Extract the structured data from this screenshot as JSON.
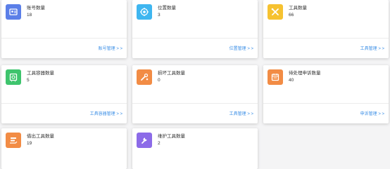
{
  "cards": [
    {
      "title": "账号数量",
      "value": "18",
      "link": "账号管理 > >",
      "icon": "user-id-icon",
      "color": "#5b7fe8"
    },
    {
      "title": "位置数量",
      "value": "3",
      "link": "位置管理 > >",
      "icon": "location-icon",
      "color": "#3fb6f0"
    },
    {
      "title": "工具数量",
      "value": "66",
      "link": "工具管理 > >",
      "icon": "tools-icon",
      "color": "#f6c231"
    },
    {
      "title": "工具容器数量",
      "value": "5",
      "link": "工具容器管理 > >",
      "icon": "container-icon",
      "color": "#3ec46d"
    },
    {
      "title": "损坏工具数量",
      "value": "0",
      "link": "工具管理 > >",
      "icon": "broken-tool-icon",
      "color": "#f28c45"
    },
    {
      "title": "待处理申诉数量",
      "value": "40",
      "link": "申诉管理 > >",
      "icon": "calendar-icon",
      "color": "#f28c45"
    },
    {
      "title": "借出工具数量",
      "value": "19",
      "icon": "lend-icon",
      "color": "#f28c45"
    },
    {
      "title": "维护工具数量",
      "value": "2",
      "icon": "wrench-icon",
      "color": "#8c6be8"
    }
  ]
}
